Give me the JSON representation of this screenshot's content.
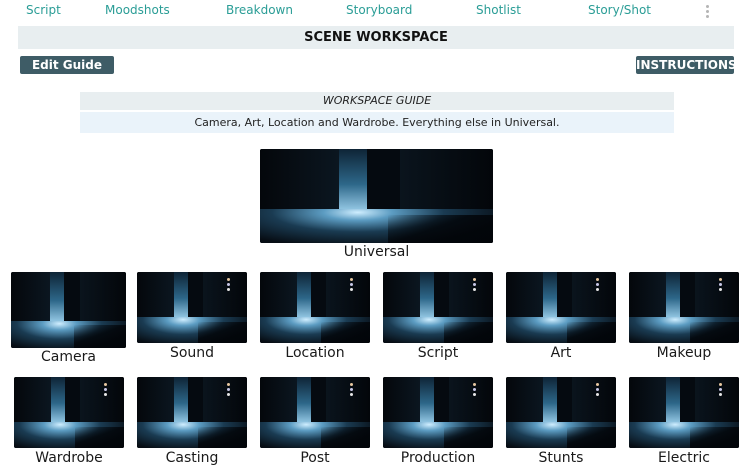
{
  "nav": {
    "items": [
      "Script",
      "Moodshots",
      "Breakdown",
      "Storyboard",
      "Shotlist",
      "Story/Shot"
    ],
    "menu_icon": "kebab-menu-icon"
  },
  "workspace": {
    "title": "SCENE WORKSPACE",
    "edit_guide_label": "Edit Guide",
    "instructions_label": "INSTRUCTIONS"
  },
  "guide": {
    "heading": "WORKSPACE GUIDE",
    "text": "Camera, Art, Location and Wardrobe. Everything else in Universal."
  },
  "universal": {
    "label": "Universal"
  },
  "departments": {
    "row1": [
      "Camera",
      "Sound",
      "Location",
      "Script",
      "Art",
      "Makeup"
    ],
    "row2": [
      "Wardrobe",
      "Casting",
      "Post",
      "Production",
      "Stunts",
      "Electric"
    ]
  },
  "colors": {
    "accent_link": "#2a9d96",
    "button_bg": "#3e5c66",
    "title_bar_bg": "#e8eef0",
    "guide_body_bg": "#eaf3fa"
  }
}
